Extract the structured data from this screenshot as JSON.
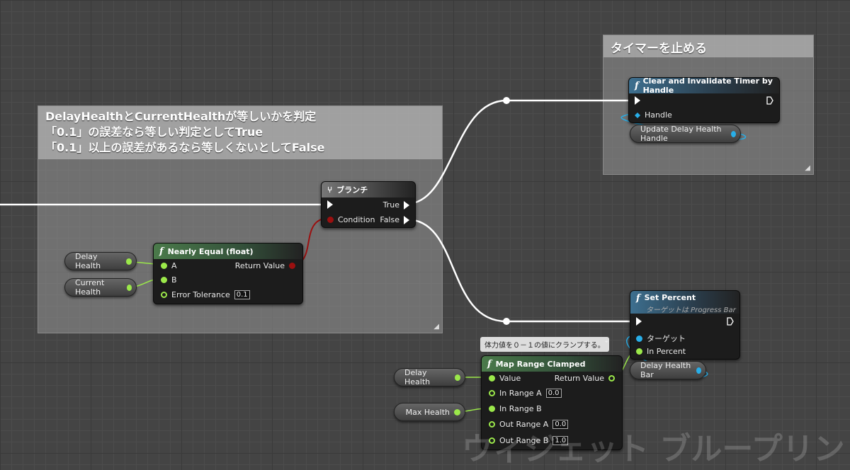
{
  "comments": {
    "timer": {
      "title": "タイマーを止める"
    },
    "compare": {
      "line1": "DelayHealthとCurrentHealthが等しいかを判定",
      "line2": "「0.1」の誤差なら等しい判定としてTrue",
      "line3": "「0.1」以上の誤差があるなら等しくないとしてFalse"
    }
  },
  "nodes": {
    "clear_timer": {
      "title": "Clear and Invalidate Timer by Handle",
      "handle_label": "Handle"
    },
    "branch": {
      "title": "ブランチ",
      "condition_label": "Condition",
      "true_label": "True",
      "false_label": "False"
    },
    "nearly_equal": {
      "title": "Nearly Equal (float)",
      "a_label": "A",
      "b_label": "B",
      "tolerance_label": "Error Tolerance",
      "tolerance_value": "0.1",
      "return_label": "Return Value"
    },
    "set_percent": {
      "title": "Set Percent",
      "subtitle": "ターゲットは Progress Bar",
      "target_label": "ターゲット",
      "percent_label": "In Percent"
    },
    "map_range": {
      "title": "Map Range Clamped",
      "value_label": "Value",
      "return_label": "Return Value",
      "in_a_label": "In Range A",
      "in_a_value": "0.0",
      "in_b_label": "In Range B",
      "out_a_label": "Out Range A",
      "out_a_value": "0.0",
      "out_b_label": "Out Range B",
      "out_b_value": "1.0",
      "comment": "体力値を０－１の値にクランプする。"
    }
  },
  "variables": {
    "update_handle": "Update Delay Health Handle",
    "delay_health_1": "Delay Health",
    "current_health": "Current Health",
    "delay_health_bar": "Delay Health Bar",
    "delay_health_2": "Delay Health",
    "max_health": "Max Health"
  },
  "watermark": "ウィジェット ブループリント",
  "colors": {
    "exec_wire": "#ffffff",
    "float_pin": "#9be84a",
    "object_pin": "#28aee8",
    "bool_pin": "#9b1010"
  }
}
